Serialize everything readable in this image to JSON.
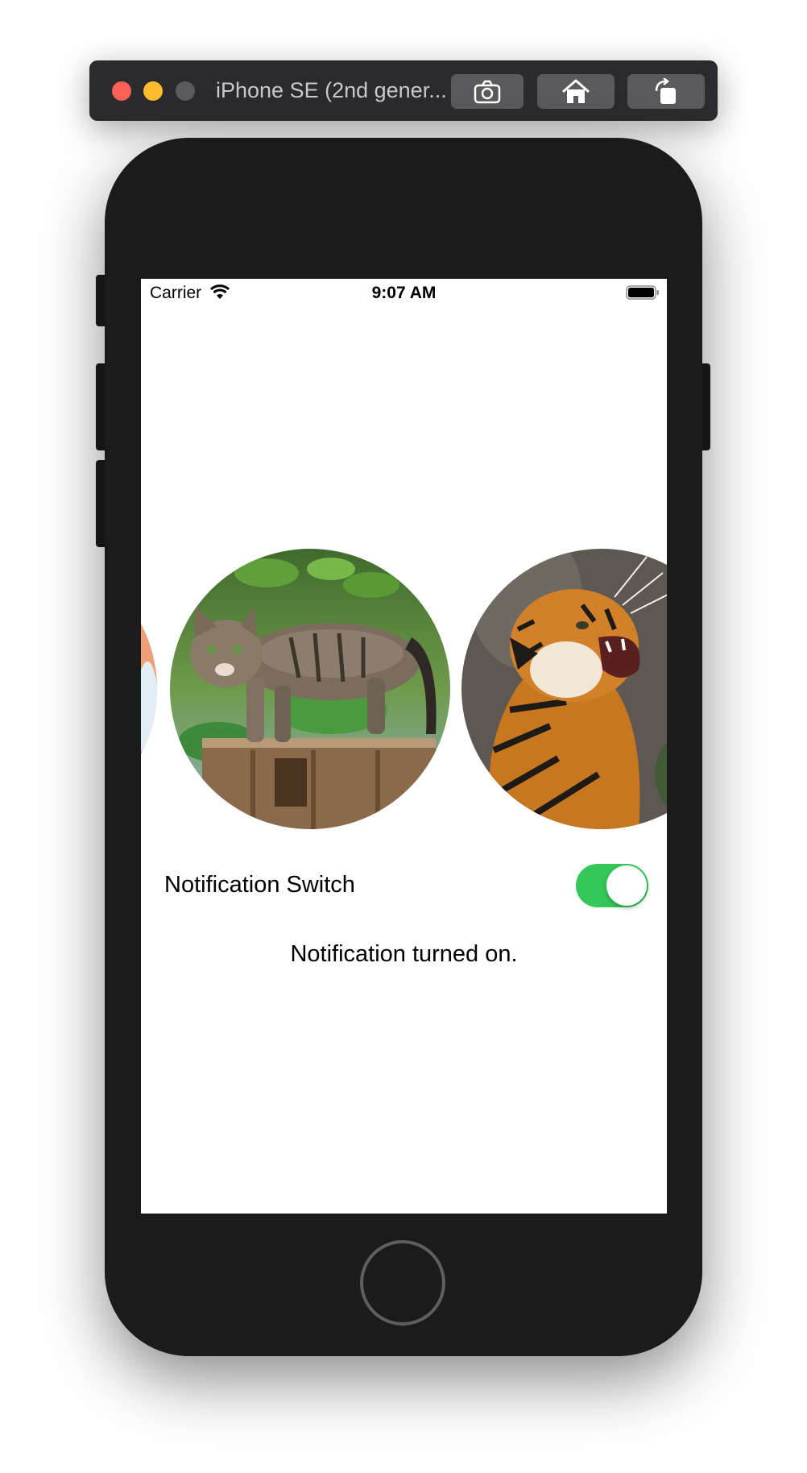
{
  "simulator": {
    "title": "iPhone SE (2nd gener...",
    "buttons": {
      "screenshot_icon": "camera-icon",
      "home_icon": "home-icon",
      "rotate_icon": "rotate-icon"
    }
  },
  "status_bar": {
    "carrier": "Carrier",
    "time": "9:07 AM",
    "wifi_icon": "wifi-icon",
    "battery_icon": "battery-icon"
  },
  "carousel": {
    "images": [
      {
        "name": "partial-image"
      },
      {
        "name": "cat"
      },
      {
        "name": "tiger"
      }
    ]
  },
  "settings": {
    "switch_label": "Notification Switch",
    "switch_on": true,
    "status_message": "Notification turned on."
  },
  "colors": {
    "switch_on": "#34c759",
    "device_body": "#1b1b1b",
    "sim_bar": "#2b2b2d"
  }
}
